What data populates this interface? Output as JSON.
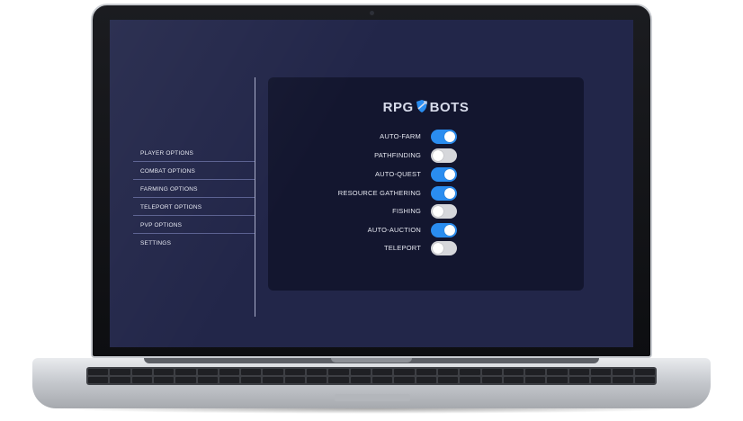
{
  "app": {
    "logo_left": "RPG",
    "logo_right": "BOTS"
  },
  "sidebar": {
    "items": [
      {
        "label": "PLAYER OPTIONS",
        "active": true
      },
      {
        "label": "COMBAT OPTIONS"
      },
      {
        "label": "FARMING OPTIONS"
      },
      {
        "label": "TELEPORT OPTIONS"
      },
      {
        "label": "PVP OPTIONS"
      },
      {
        "label": "SETTINGS"
      }
    ]
  },
  "options": [
    {
      "label": "AUTO-FARM",
      "enabled": true
    },
    {
      "label": "PATHFINDING",
      "enabled": false
    },
    {
      "label": "AUTO-QUEST",
      "enabled": true
    },
    {
      "label": "RESOURCE GATHERING",
      "enabled": true
    },
    {
      "label": "FISHING",
      "enabled": false
    },
    {
      "label": "AUTO-AUCTION",
      "enabled": true
    },
    {
      "label": "TELEPORT",
      "enabled": false
    }
  ],
  "colors": {
    "screen_bg": "#222649",
    "panel_bg": "#13162f",
    "toggle_on": "#2a8df0",
    "toggle_off": "#d6d7db"
  }
}
